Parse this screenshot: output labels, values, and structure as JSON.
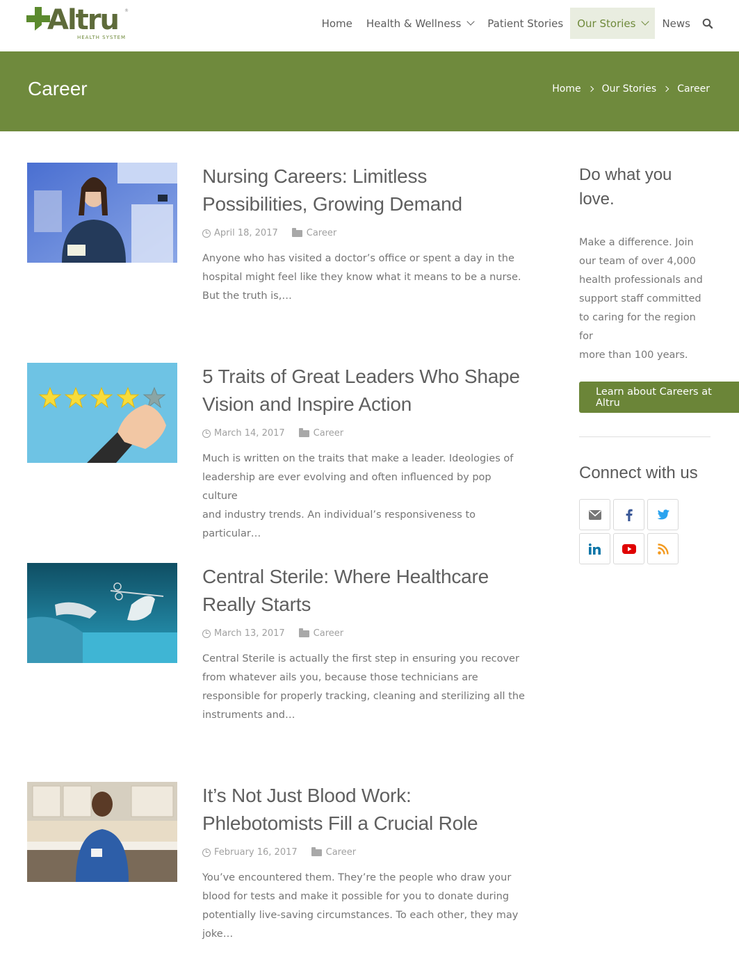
{
  "header": {
    "logo_word": "Altru",
    "logo_sub": "HEALTH SYSTEM",
    "logo_reg": "®",
    "nav": [
      "Home",
      "Health & Wellness",
      "Patient Stories",
      "Our Stories",
      "News"
    ],
    "accent": "#6f8a3d"
  },
  "banner": {
    "title": "Career",
    "breadcrumb": [
      "Home",
      "Our Stories",
      "Career"
    ]
  },
  "posts": [
    {
      "title_1": "Nursing Careers: Limitless",
      "title_2": "Possibilities, Growing Demand",
      "date": "April 18, 2017",
      "category": "Career",
      "excerpt_lines": [
        "Anyone who has visited a doctor’s office or spent a day in the",
        "hospital might feel like they know what it means to be a nurse.",
        "But the truth is,…"
      ]
    },
    {
      "title_1": "5 Traits of Great Leaders Who Shape",
      "title_2": "Vision and Inspire Action",
      "date": "March 14, 2017",
      "category": "Career",
      "excerpt_lines": [
        "Much is written on the traits that make a leader. Ideologies of",
        "leadership are ever evolving and often influenced by pop culture",
        "and industry trends. An individual’s responsiveness to particular…"
      ]
    },
    {
      "title_1": "Central Sterile: Where Healthcare",
      "title_2": "Really Starts",
      "date": "March 13, 2017",
      "category": "Career",
      "excerpt_lines": [
        "Central Sterile is actually the first step in ensuring you recover",
        "from whatever ails you, because those technicians are",
        "responsible for properly tracking, cleaning and sterilizing all the",
        "instruments and…"
      ]
    },
    {
      "title_1": "It’s Not Just Blood Work:",
      "title_2": "Phlebotomists Fill a Crucial Role",
      "date": "February 16, 2017",
      "category": "Career",
      "excerpt_lines": [
        "You’ve encountered them. They’re the people who draw your",
        "blood for tests and make it possible for you to donate during",
        "potentially live-saving circumstances. To each other, they may",
        "joke…"
      ]
    }
  ],
  "sidebar": {
    "heading_1": "Do what you",
    "heading_2": "love.",
    "text_lines": [
      "Make a difference. Join",
      "our team of over 4,000",
      "health professionals and",
      "support staff committed",
      "to caring for the region for",
      "more than 100 years."
    ],
    "cta": "Learn about Careers at Altru",
    "connect": "Connect with us",
    "social_icons": [
      "email-icon",
      "facebook-icon",
      "twitter-icon",
      "linkedin-icon",
      "youtube-icon",
      "rss-icon"
    ]
  }
}
